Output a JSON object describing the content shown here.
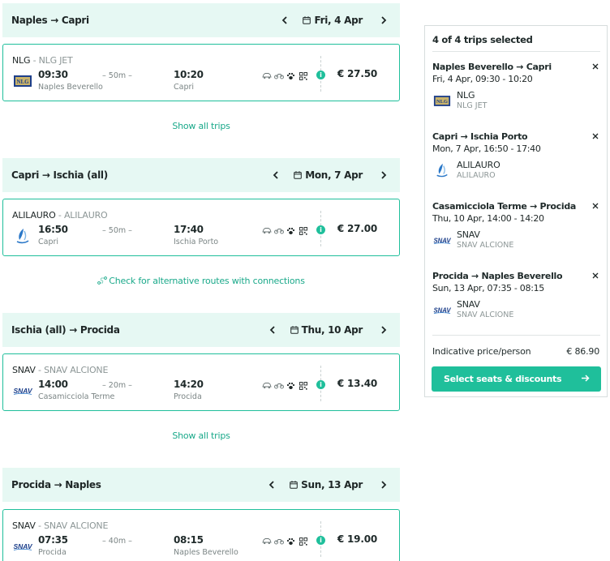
{
  "legs": [
    {
      "route": "Naples → Capri",
      "date": "Fri, 4 Apr",
      "trip": {
        "operator": "NLG",
        "vessel": "NLG JET",
        "logo": "nlg-logo",
        "dep_time": "09:30",
        "dep_port": "Naples Beverello",
        "duration": "– 50m –",
        "arr_time": "10:20",
        "arr_port": "Capri",
        "price": "€ 27.50"
      },
      "link": "Show all trips"
    },
    {
      "route": "Capri → Ischia (all)",
      "date": "Mon, 7 Apr",
      "trip": {
        "operator": "ALILAURO",
        "vessel": "ALILAURO",
        "logo": "alilauro-logo",
        "dep_time": "16:50",
        "dep_port": "Capri",
        "duration": "– 50m –",
        "arr_time": "17:40",
        "arr_port": "Ischia Porto",
        "price": "€ 27.00"
      },
      "link": "Check for alternative routes with connections"
    },
    {
      "route": "Ischia (all) → Procida",
      "date": "Thu, 10 Apr",
      "trip": {
        "operator": "SNAV",
        "vessel": "SNAV ALCIONE",
        "logo": "snav-logo",
        "dep_time": "14:00",
        "dep_port": "Casamicciola Terme",
        "duration": "– 20m –",
        "arr_time": "14:20",
        "arr_port": "Procida",
        "price": "€ 13.40"
      },
      "link": "Show all trips"
    },
    {
      "route": "Procida → Naples",
      "date": "Sun, 13 Apr",
      "trip": {
        "operator": "SNAV",
        "vessel": "SNAV ALCIONE",
        "logo": "snav-logo",
        "dep_time": "07:35",
        "dep_port": "Procida",
        "duration": "– 40m –",
        "arr_time": "08:15",
        "arr_port": "Naples Beverello",
        "price": "€ 19.00"
      }
    }
  ],
  "separators": {
    "operator": " - "
  },
  "amenity_icons": [
    "car-icon",
    "motorbike-icon",
    "pet-paw-icon",
    "qr-ticket-icon"
  ],
  "info_glyph": "i",
  "summary": {
    "title": "4 of 4 trips selected",
    "trips": [
      {
        "route": "Naples Beverello → Capri",
        "when": "Fri, 4 Apr, 09:30 - 10:20",
        "operator": "NLG",
        "vessel": "NLG JET",
        "logo": "nlg-logo"
      },
      {
        "route": "Capri → Ischia Porto",
        "when": "Mon, 7 Apr, 16:50 - 17:40",
        "operator": "ALILAURO",
        "vessel": "ALILAURO",
        "logo": "alilauro-logo"
      },
      {
        "route": "Casamicciola Terme → Procida",
        "when": "Thu, 10 Apr, 14:00 - 14:20",
        "operator": "SNAV",
        "vessel": "SNAV ALCIONE",
        "logo": "snav-logo"
      },
      {
        "route": "Procida → Naples Beverello",
        "when": "Sun, 13 Apr, 07:35 - 08:15",
        "operator": "SNAV",
        "vessel": "SNAV ALCIONE",
        "logo": "snav-logo"
      }
    ],
    "price_label": "Indicative price/person",
    "price_value": "€ 86.90",
    "cta_label": "Select seats & discounts"
  },
  "colors": {
    "accent": "#1fbf9b",
    "header_bg": "#e6f8f3",
    "link": "#1aa98a"
  }
}
